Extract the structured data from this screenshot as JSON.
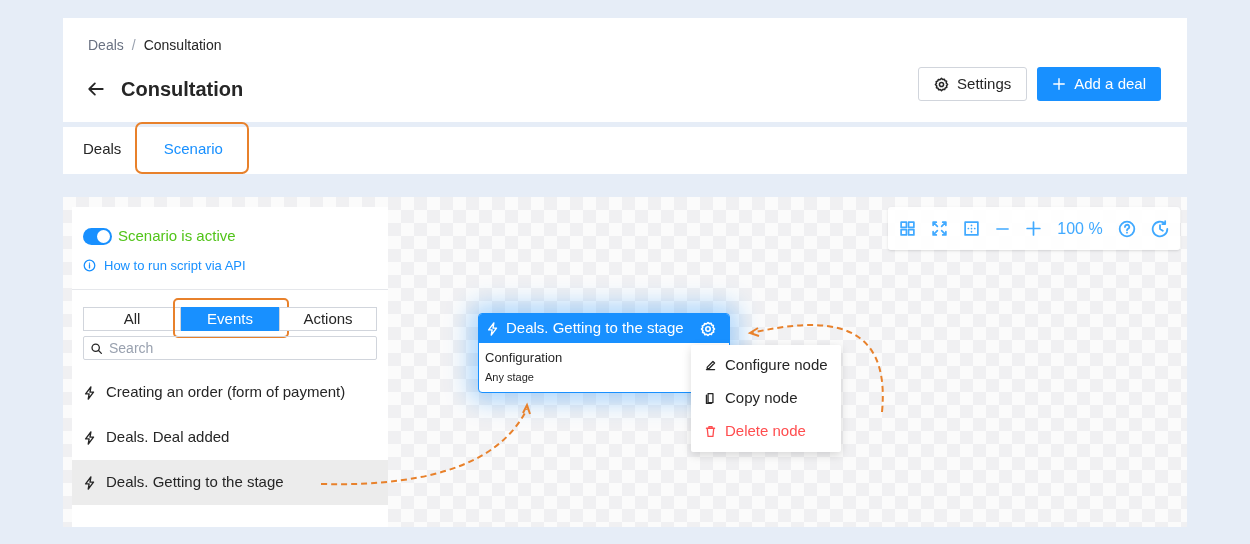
{
  "breadcrumb": [
    "Deals",
    "Consultation"
  ],
  "breadcrumb_separator": "/",
  "title": "Consultation",
  "header_buttons": [
    {
      "kind": "settings",
      "label": "Settings"
    },
    {
      "kind": "primary",
      "label": "Add a deal"
    }
  ],
  "tabs": [
    {
      "label": "Deals",
      "selected": false,
      "highlighted": false
    },
    {
      "label": "Scenario",
      "selected": true,
      "highlighted": true
    }
  ],
  "panel": {
    "active": true,
    "status": "Scenario is active",
    "help_link": "How to run script via API",
    "filters": [
      {
        "label": "All",
        "selected": false,
        "highlighted": false
      },
      {
        "label": "Events",
        "selected": true,
        "highlighted": true
      },
      {
        "label": "Actions",
        "selected": false,
        "highlighted": false
      }
    ],
    "search": {
      "placeholder": "Search"
    },
    "events": [
      {
        "label": "Creating an order (form of payment)",
        "selected": false
      },
      {
        "label": "Deals. Deal added",
        "selected": false
      },
      {
        "label": "Deals. Getting to the stage",
        "selected": true
      }
    ]
  },
  "toolbar": {
    "zoom": "100 %"
  },
  "node": {
    "title": "Deals. Getting to the stage",
    "config_label": "Configuration",
    "config_value": "Any stage"
  },
  "context_menu": [
    {
      "kind": "edit",
      "label": "Configure node"
    },
    {
      "kind": "copy",
      "label": "Copy node"
    },
    {
      "kind": "delete",
      "label": "Delete node"
    }
  ]
}
